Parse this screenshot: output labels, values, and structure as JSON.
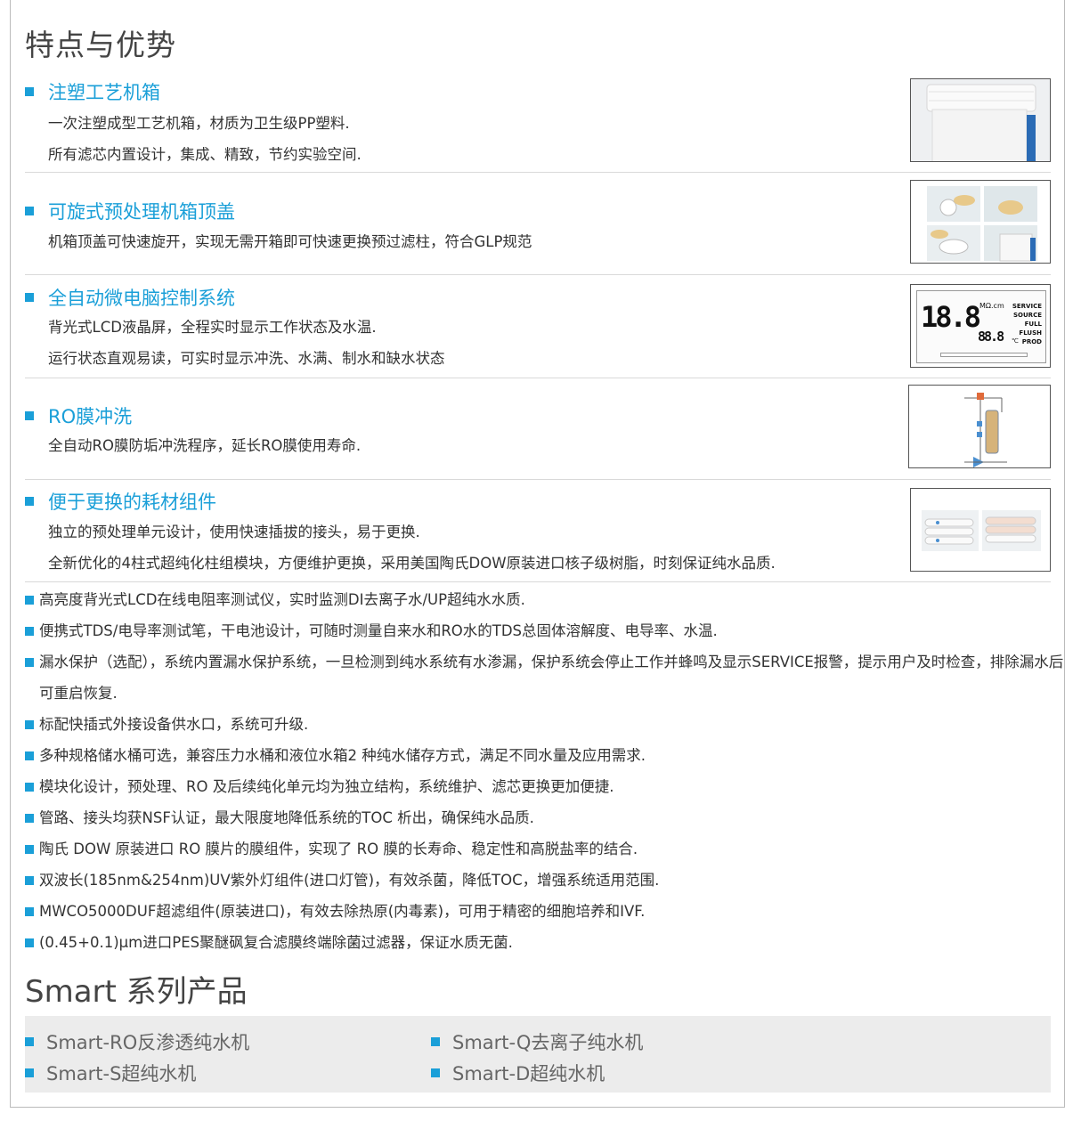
{
  "page_title": "特点与优势",
  "sections": [
    {
      "title": "注塑工艺机箱",
      "lines": [
        "一次注塑成型工艺机箱，材质为卫生级PP塑料.",
        "所有滤芯内置设计，集成、精致，节约实验空间."
      ]
    },
    {
      "title": "可旋式预处理机箱顶盖",
      "lines": [
        "机箱顶盖可快速旋开，实现无需开箱即可快速更换预过滤柱，符合GLP规范"
      ]
    },
    {
      "title": "全自动微电脑控制系统",
      "lines": [
        "背光式LCD液晶屏，全程实时显示工作状态及水温.",
        "运行状态直观易读，可实时显示冲洗、水满、制水和缺水状态"
      ]
    },
    {
      "title": "RO膜冲洗",
      "lines": [
        "全自动RO膜防垢冲洗程序，延长RO膜使用寿命."
      ]
    },
    {
      "title": "便于更换的耗材组件",
      "lines": [
        "独立的预处理单元设计，使用快速插拔的接头，易于更换.",
        "全新优化的4柱式超纯化柱组模块，方便维护更换，采用美国陶氏DOW原装进口核子级树脂，时刻保证纯水品质."
      ]
    }
  ],
  "lcd": {
    "main": "18.8",
    "unit": "MΩ.cm",
    "temp": "88.8",
    "temp_unit": "℃",
    "labels": [
      "SERVICE",
      "SOURCE",
      "FULL",
      "FLUSH",
      "PROD"
    ]
  },
  "bullets": [
    "高亮度背光式LCD在线电阻率测试仪，实时监测DI去离子水/UP超纯水水质.",
    "便携式TDS/电导率测试笔，干电池设计，可随时测量自来水和RO水的TDS总固体溶解度、电导率、水温.",
    "漏水保护（选配），系统内置漏水保护系统，一旦检测到纯水系统有水渗漏，保护系统会停止工作并蜂鸣及显示SERVICE报警，提示用户及时检查，排除漏水后可重启恢复.",
    "标配快插式外接设备供水口，系统可升级.",
    "多种规格储水桶可选，兼容压力水桶和液位水箱2 种纯水储存方式，满足不同水量及应用需求.",
    "模块化设计，预处理、RO 及后续纯化单元均为独立结构，系统维护、滤芯更换更加便捷.",
    "管路、接头均获NSF认证，最大限度地降低系统的TOC 析出，确保纯水品质.",
    "陶氏 DOW 原装进口 RO 膜片的膜组件，实现了 RO 膜的长寿命、稳定性和高脱盐率的结合.",
    "双波长(185nm&254nm)UV紫外灯组件(进口灯管)，有效杀菌，降低TOC，增强系统适用范围.",
    "MWCO5000DUF超滤组件(原装进口)，有效去除热原(内毒素)，可用于精密的细胞培养和IVF.",
    "(0.45+0.1)μm进口PES聚醚砜复合滤膜终端除菌过滤器，保证水质无菌."
  ],
  "series_title": "Smart 系列产品",
  "series": [
    "Smart-RO反渗透纯水机",
    "Smart-Q去离子纯水机",
    "Smart-S超纯水机",
    "Smart-D超纯水机"
  ],
  "colors": {
    "accent": "#1a9fd8",
    "text": "#333333",
    "series_bg": "#ececec"
  }
}
